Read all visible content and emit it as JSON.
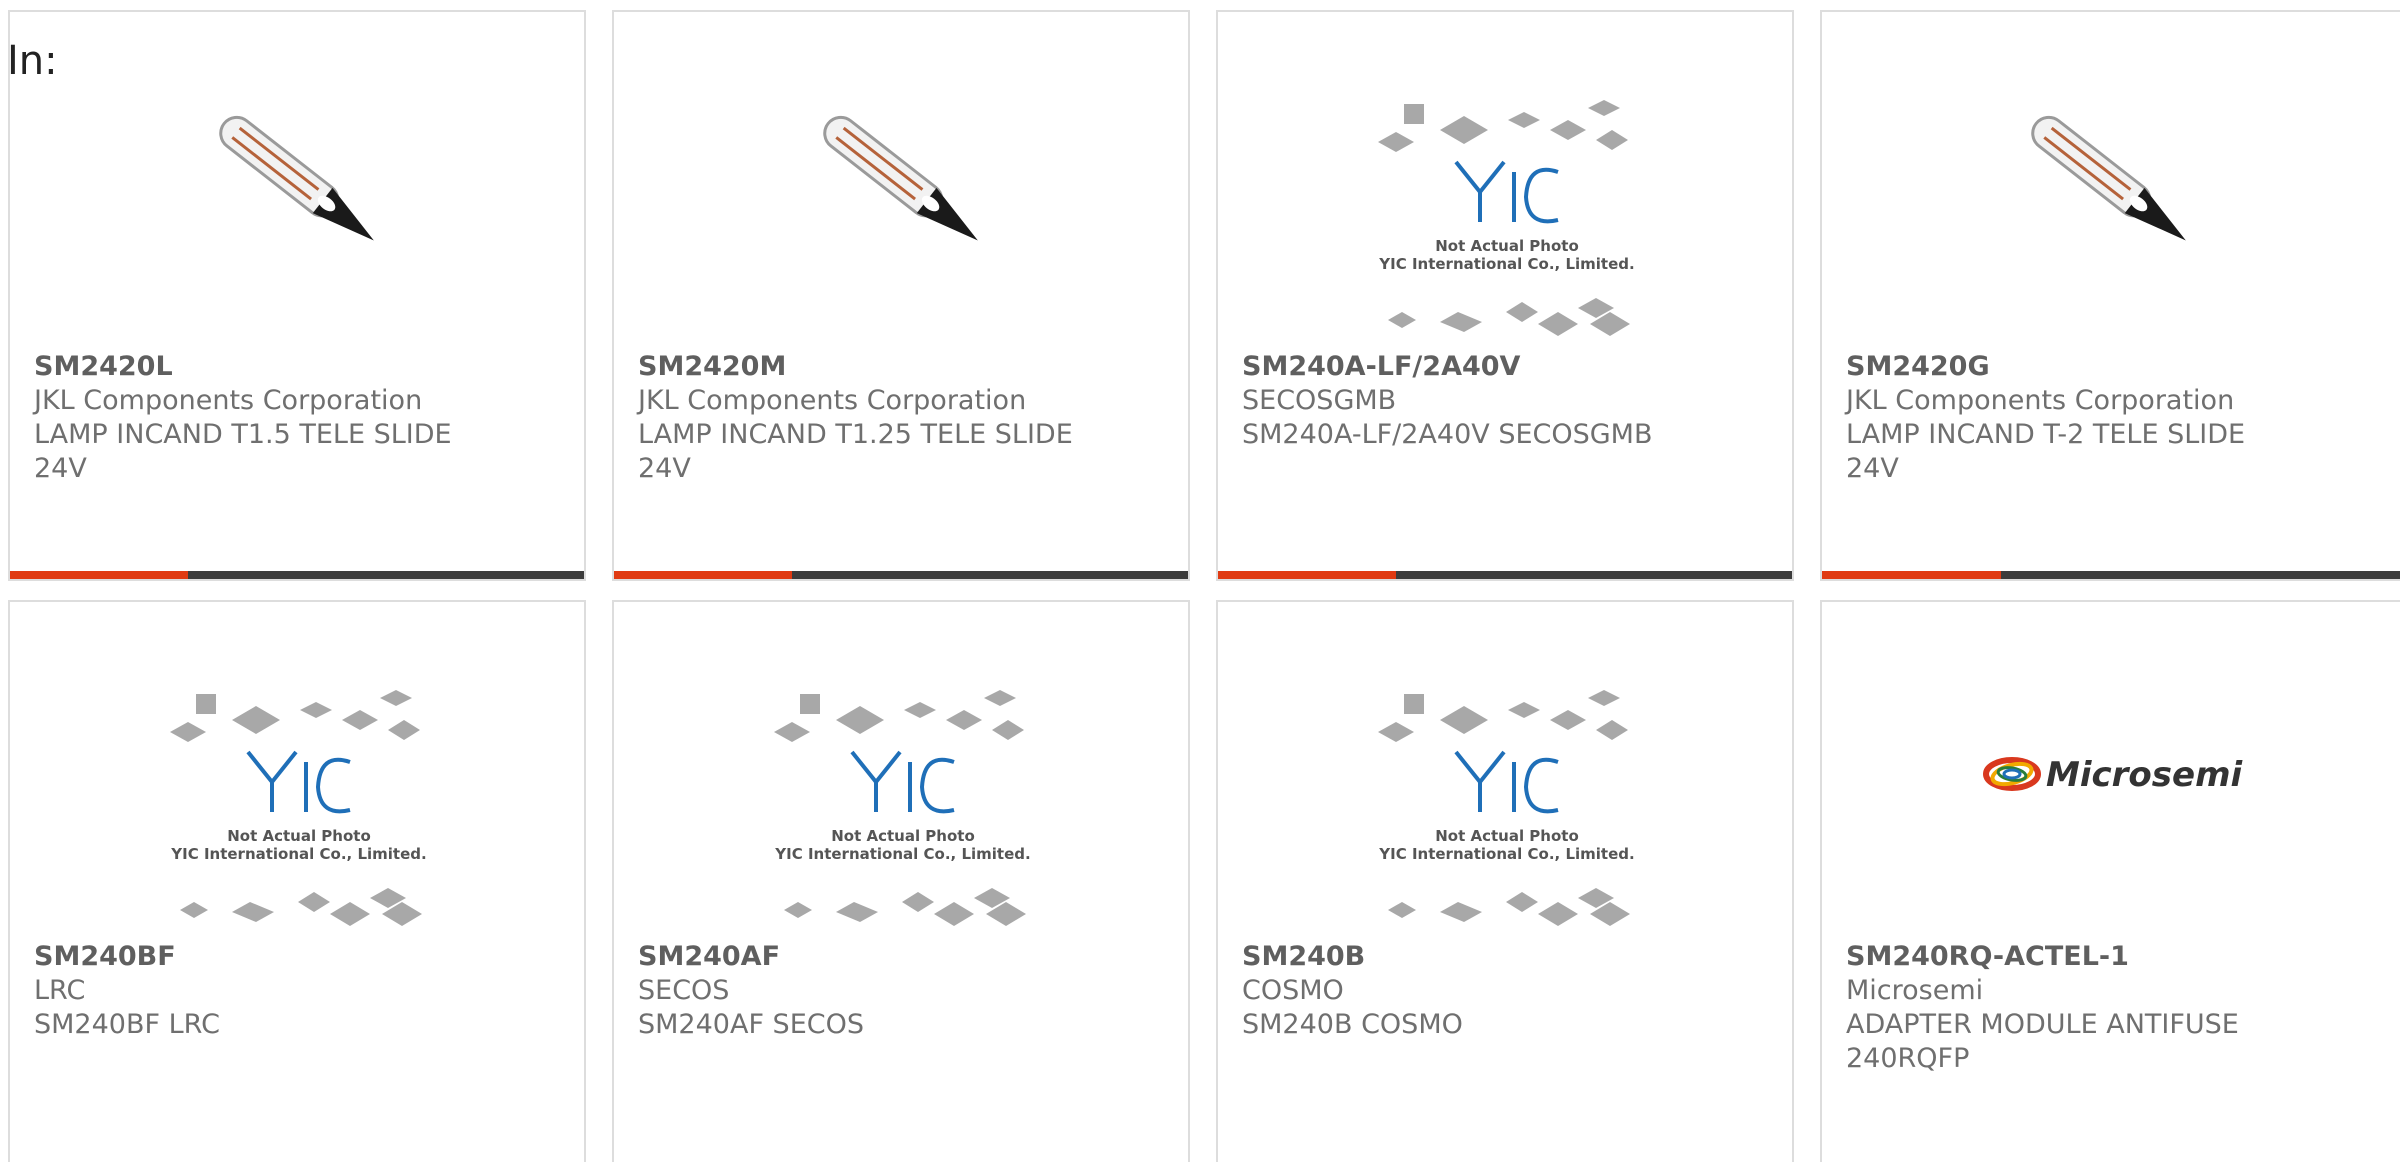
{
  "header": {
    "in_label": "In:"
  },
  "colors": {
    "accent": "#e03a12",
    "bar": "#3c3c3c",
    "yic_blue": "#1f6fb8"
  },
  "products": [
    {
      "part_number": "SM2420L",
      "manufacturer": "JKL Components Corporation",
      "desc_line1": "LAMP INCAND T1.5 TELE SLIDE",
      "desc_line2": "24V",
      "image": "lamp-bulb-image"
    },
    {
      "part_number": "SM2420M",
      "manufacturer": "JKL Components Corporation",
      "desc_line1": "LAMP INCAND T1.25 TELE SLIDE",
      "desc_line2": "24V",
      "image": "lamp-bulb-image"
    },
    {
      "part_number": "SM240A-LF/2A40V",
      "manufacturer": "SECOSGMB",
      "desc_line1": "SM240A-LF/2A40V SECOSGMB",
      "desc_line2": "",
      "image": "yic-placeholder-image",
      "placeholder_text1": "Not Actual Photo",
      "placeholder_text2": "YIC International Co., Limited."
    },
    {
      "part_number": "SM2420G",
      "manufacturer": "JKL Components Corporation",
      "desc_line1": "LAMP INCAND T-2 TELE SLIDE",
      "desc_line2": "24V",
      "image": "lamp-bulb-image"
    },
    {
      "part_number": "SM240BF",
      "manufacturer": "LRC",
      "desc_line1": "SM240BF LRC",
      "desc_line2": "",
      "image": "yic-placeholder-image",
      "placeholder_text1": "Not Actual Photo",
      "placeholder_text2": "YIC International Co., Limited."
    },
    {
      "part_number": "SM240AF",
      "manufacturer": "SECOS",
      "desc_line1": "SM240AF SECOS",
      "desc_line2": "",
      "image": "yic-placeholder-image",
      "placeholder_text1": "Not Actual Photo",
      "placeholder_text2": "YIC International Co., Limited."
    },
    {
      "part_number": "SM240B",
      "manufacturer": "COSMO",
      "desc_line1": "SM240B COSMO",
      "desc_line2": "",
      "image": "yic-placeholder-image",
      "placeholder_text1": "Not Actual Photo",
      "placeholder_text2": "YIC International Co., Limited."
    },
    {
      "part_number": "SM240RQ-ACTEL-1",
      "manufacturer": "Microsemi",
      "desc_line1": "ADAPTER MODULE ANTIFUSE",
      "desc_line2": "240RQFP",
      "image": "microsemi-logo-image",
      "logo_text": "Microsemi"
    }
  ],
  "bar_progress_fraction": 0.31
}
